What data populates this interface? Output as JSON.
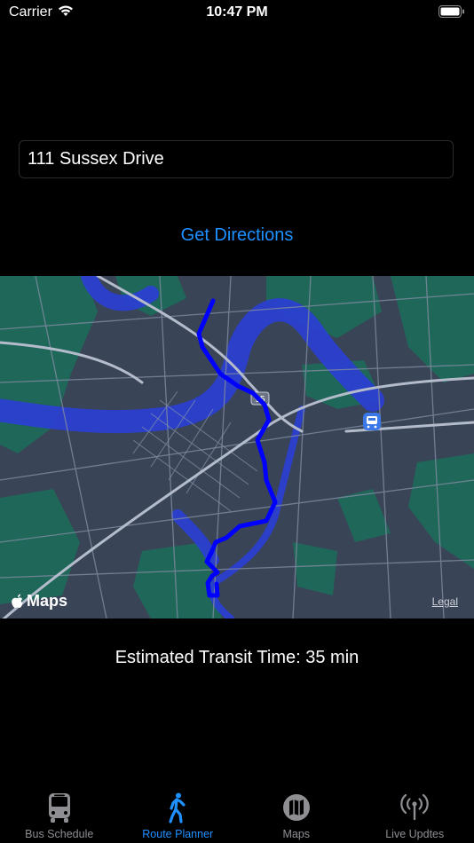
{
  "status_bar": {
    "carrier": "Carrier",
    "time": "10:47 PM"
  },
  "search": {
    "value": "111 Sussex Drive"
  },
  "actions": {
    "get_directions": "Get Directions"
  },
  "map": {
    "provider_label": "Maps",
    "legal_label": "Legal",
    "highway_shield": "95",
    "route_color": "#0000ff"
  },
  "eta": {
    "text": "Estimated Transit Time: 35 min"
  },
  "tabs": [
    {
      "label": "Bus Schedule",
      "icon": "bus-icon",
      "active": false
    },
    {
      "label": "Route Planner",
      "icon": "walking-person-icon",
      "active": true
    },
    {
      "label": "Maps",
      "icon": "map-icon",
      "active": false
    },
    {
      "label": "Live Updtes",
      "icon": "antenna-icon",
      "active": false
    }
  ],
  "colors": {
    "accent": "#1e90ff",
    "inactive": "#8e8e93"
  }
}
